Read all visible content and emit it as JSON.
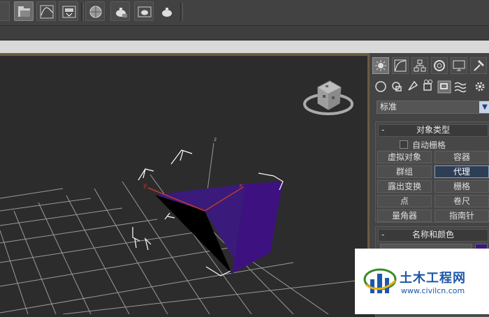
{
  "toolbar": {
    "icons": [
      "teapot-render-icon",
      "folder-open-icon",
      "curve-editor-icon",
      "render-setup-icon",
      "material-editor-icon",
      "render-frame-icon",
      "render-production-icon",
      "render-iterative-icon"
    ]
  },
  "viewport": {
    "axis_labels": {
      "x": "x",
      "y": "y",
      "z": "z"
    },
    "object_colors": {
      "side": "#3a1a7a",
      "dark": "#000000",
      "selection": "#ffffff"
    }
  },
  "command_panel": {
    "tabs": [
      "create-tab",
      "modify-tab",
      "hierarchy-tab",
      "motion-tab",
      "display-tab",
      "utilities-tab"
    ],
    "subtabs": [
      "geometry-icon",
      "shapes-icon",
      "lights-icon",
      "cameras-icon",
      "helpers-icon",
      "space-warps-icon",
      "systems-icon"
    ],
    "dropdown": {
      "value": "标准"
    },
    "object_type": {
      "title": "对象类型",
      "autogrid_label": "自动栅格",
      "buttons": [
        "虚拟对象",
        "容器",
        "群组",
        "代理",
        "露出变换",
        "栅格",
        "点",
        "卷尺",
        "量角器",
        "指南针"
      ],
      "active_button": "代理"
    },
    "name_color": {
      "title": "名称和颜色"
    }
  },
  "watermark": {
    "title": "土木工程网",
    "url": "www.civilcn.com"
  }
}
